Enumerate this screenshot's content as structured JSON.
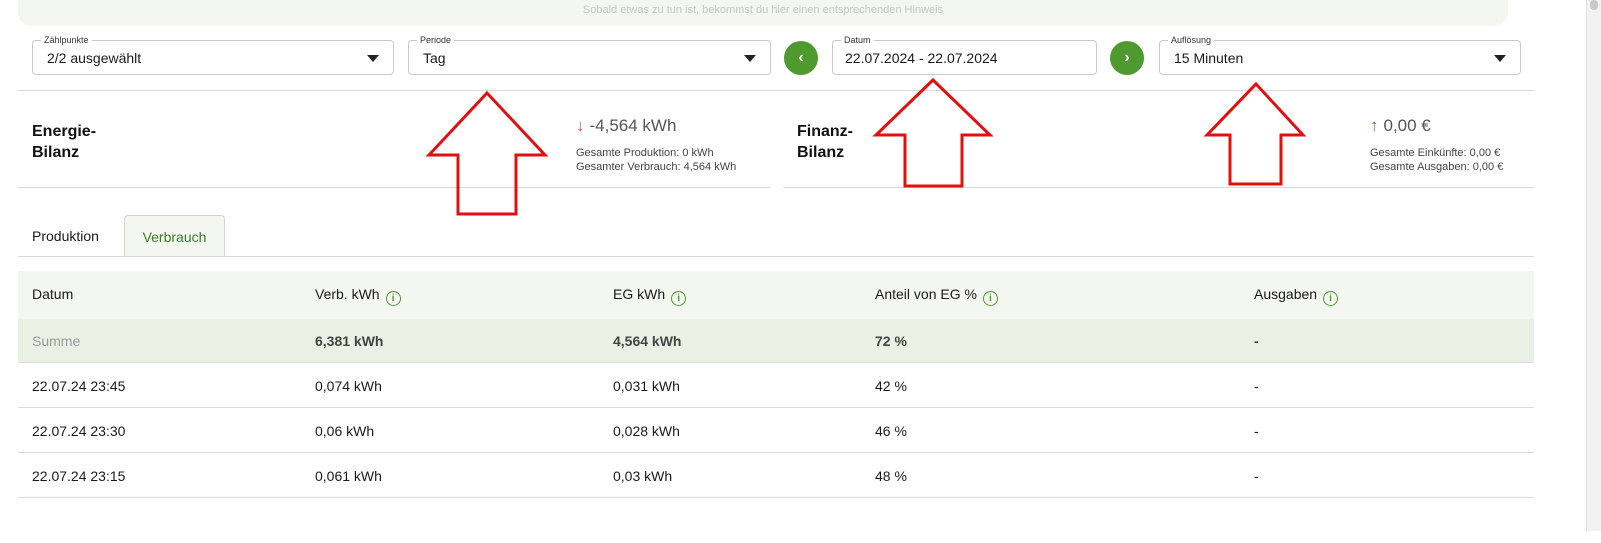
{
  "notice": {
    "text": "Sobald etwas zu tun ist, bekommst du hier einen entsprechenden Hinweis"
  },
  "filters": {
    "zaehlpunkte": {
      "label": "Zählpunkte",
      "value": "2/2 ausgewählt"
    },
    "periode": {
      "label": "Periode",
      "value": "Tag"
    },
    "datum": {
      "label": "Datum",
      "value": "22.07.2024 - 22.07.2024"
    },
    "aufloesung": {
      "label": "Auflösung",
      "value": "15 Minuten"
    },
    "prev_icon": "‹",
    "next_icon": "›"
  },
  "energie": {
    "title_line1": "Energie-",
    "title_line2": "Bilanz",
    "arrow": "↓",
    "value": "-4,564 kWh",
    "sub1": "Gesamte Produktion: 0 kWh",
    "sub2": "Gesamter Verbrauch: 4,564 kWh"
  },
  "finanz": {
    "title_line1": "Finanz-",
    "title_line2": "Bilanz",
    "arrow": "↑",
    "value": "0,00 €",
    "sub1": "Gesamte Einkünfte: 0,00 €",
    "sub2": "Gesamte Ausgaben: 0,00 €"
  },
  "tabs": {
    "produktion": "Produktion",
    "verbrauch": "Verbrauch"
  },
  "table": {
    "headers": {
      "datum": "Datum",
      "verb": "Verb. kWh",
      "eg": "EG kWh",
      "anteil": "Anteil von EG %",
      "ausgaben": "Ausgaben"
    },
    "info_icon": "i",
    "summe": {
      "datum": "Summe",
      "verb": "6,381 kWh",
      "eg": "4,564 kWh",
      "anteil": "72 %",
      "ausgaben": "-"
    },
    "rows": [
      {
        "datum": "22.07.24 23:45",
        "verb": "0,074 kWh",
        "eg": "0,031 kWh",
        "anteil": "42 %",
        "ausgaben": "-"
      },
      {
        "datum": "22.07.24 23:30",
        "verb": "0,06 kWh",
        "eg": "0,028 kWh",
        "anteil": "46 %",
        "ausgaben": "-"
      },
      {
        "datum": "22.07.24 23:15",
        "verb": "0,061 kWh",
        "eg": "0,03 kWh",
        "anteil": "48 %",
        "ausgaben": "-"
      }
    ]
  },
  "colors": {
    "accent": "#4e9a2e",
    "annotation": "#e01010",
    "negative": "#e05252"
  }
}
